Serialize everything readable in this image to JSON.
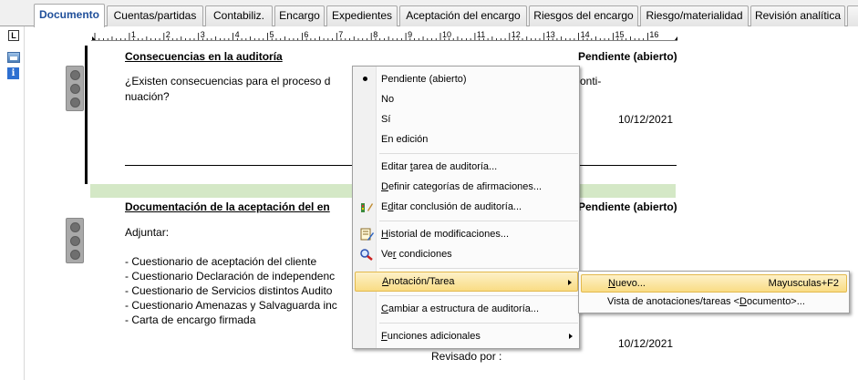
{
  "tabs": [
    {
      "label": "Documento",
      "active": true
    },
    {
      "label": "Cuentas/partidas"
    },
    {
      "label": "Contabiliz."
    },
    {
      "label": "Encargo"
    },
    {
      "label": "Expedientes"
    },
    {
      "label": "Aceptación del encargo"
    },
    {
      "label": "Riesgos del encargo"
    },
    {
      "label": "Riesgo/materialidad"
    },
    {
      "label": "Revisión analítica"
    }
  ],
  "ruler": {
    "tab_marker": "L",
    "numbers": [
      "1",
      "2",
      "3",
      "4",
      "5",
      "6",
      "7",
      "8",
      "9",
      "10",
      "11",
      "12",
      "13",
      "14",
      "15",
      "16"
    ]
  },
  "icons": {
    "sidebar": [
      "table-icon",
      "info-icon"
    ],
    "traffic_light": "traffic-light-icon"
  },
  "section1": {
    "heading": "Consecuencias en la auditoría",
    "status": "Pendiente (abierto)",
    "question_line1": "¿Existen consecuencias para el proceso d",
    "question_line1_end": "onti-",
    "question_line2": "nuación?",
    "date": "10/12/2021"
  },
  "section2": {
    "heading": "Documentación de la aceptación del en",
    "status": "Pendiente (abierto)",
    "intro": "Adjuntar:",
    "items": [
      "- Cuestionario de aceptación del cliente",
      "- Cuestionario Declaración de independenc",
      "- Cuestionario de Servicios distintos Audito",
      "- Cuestionario Amenazas y Salvaguarda inc",
      "- Carta de encargo firmada"
    ],
    "date": "10/12/2021",
    "reviewed_by": "Revisado por :"
  },
  "context_menu": {
    "status_items": [
      {
        "label": "Pendiente (abierto)",
        "checked": true
      },
      {
        "label": "No"
      },
      {
        "label": "Sí"
      },
      {
        "label": "En edición"
      }
    ],
    "edit_task": {
      "pre": "Editar ",
      "u": "t",
      "post": "area de auditoría..."
    },
    "define_categories": {
      "pre": "",
      "u": "D",
      "post": "efinir categorías de afirmaciones..."
    },
    "edit_conclusion": {
      "pre": "E",
      "u": "d",
      "post": "itar conclusión de auditoría..."
    },
    "history": {
      "pre": "",
      "u": "H",
      "post": "istorial de modificaciones..."
    },
    "view_conditions": {
      "pre": "Ve",
      "u": "r",
      "post": " condiciones"
    },
    "annotation": {
      "pre": "",
      "u": "A",
      "post": "notación/Tarea"
    },
    "change_structure": {
      "pre": "",
      "u": "C",
      "post": "ambiar a estructura de auditoría..."
    },
    "extra_functions": {
      "pre": "",
      "u": "F",
      "post": "unciones adicionales"
    },
    "icons": [
      "edit-conclusion-icon",
      "history-icon",
      "view-conditions-icon"
    ]
  },
  "submenu": {
    "new": {
      "pre": "",
      "u": "N",
      "post": "uevo...",
      "shortcut": "Mayusculas+F2"
    },
    "view": {
      "pre": "Vista de anotaciones/tareas <",
      "u": "D",
      "post": "ocumento>..."
    }
  },
  "colors": {
    "menu_highlight": "#f9dc84",
    "green_bar": "#d4e8c6",
    "active_tab_text": "#1f4f9a"
  }
}
